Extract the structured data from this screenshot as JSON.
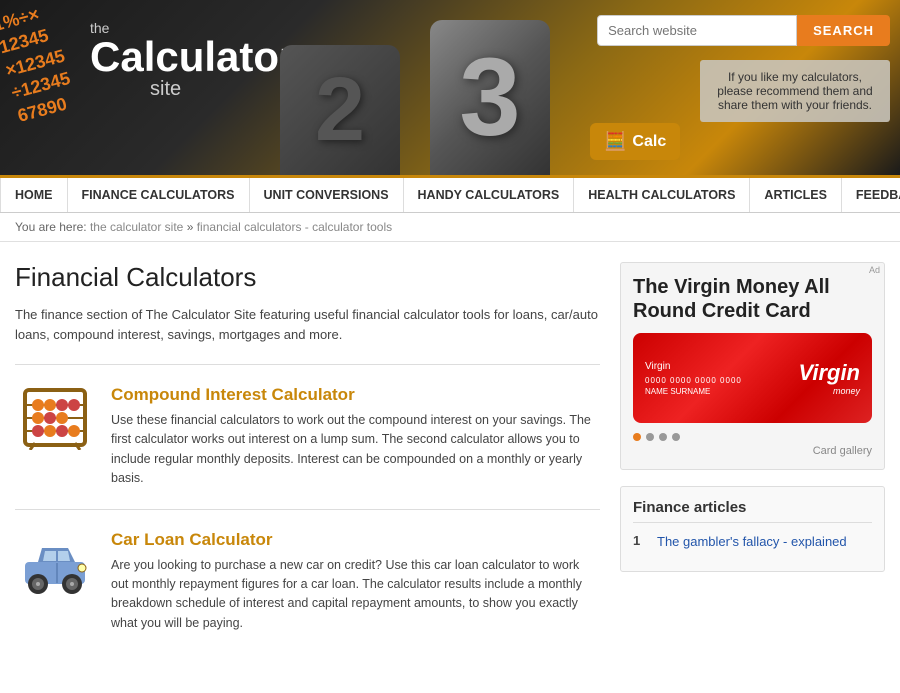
{
  "header": {
    "logo_the": "the",
    "logo_calculator": "Calculator",
    "logo_site": "site",
    "floating_numbers": "1%÷×\n12345\n×12345\n÷12345\n67890",
    "search_placeholder": "Search website",
    "search_btn_label": "SEARCH",
    "calc_icon_label": "Calc",
    "recommend_text": "If you like my calculators, please recommend them and share them with your friends."
  },
  "nav": {
    "items": [
      {
        "label": "HOME",
        "href": "#"
      },
      {
        "label": "FINANCE CALCULATORS",
        "href": "#"
      },
      {
        "label": "UNIT CONVERSIONS",
        "href": "#"
      },
      {
        "label": "HANDY CALCULATORS",
        "href": "#"
      },
      {
        "label": "HEALTH CALCULATORS",
        "href": "#"
      },
      {
        "label": "ARTICLES",
        "href": "#"
      },
      {
        "label": "FEEDBACK",
        "href": "#"
      }
    ]
  },
  "breadcrumb": {
    "prefix": "You are here:",
    "items": [
      {
        "label": "the calculator site",
        "href": "#"
      },
      {
        "label": "financial calculators - calculator tools",
        "href": "#"
      }
    ]
  },
  "main": {
    "page_title": "Financial Calculators",
    "intro": "The finance section of The Calculator Site featuring useful financial calculator tools for loans, car/auto loans, compound interest, savings, mortgages and more.",
    "calculators": [
      {
        "id": "compound-interest",
        "title": "Compound Interest Calculator",
        "description": "Use these financial calculators to work out the compound interest on your savings. The first calculator works out interest on a lump sum. The second calculator allows you to include regular monthly deposits. Interest can be compounded on a monthly or yearly basis.",
        "icon_type": "abacus"
      },
      {
        "id": "car-loan",
        "title": "Car Loan Calculator",
        "description": "Are you looking to purchase a new car on credit? Use this car loan calculator to work out monthly repayment figures for a car loan. The calculator results include a monthly breakdown schedule of interest and capital repayment amounts, to show you exactly what you will be paying.",
        "icon_type": "car"
      }
    ]
  },
  "sidebar": {
    "ad": {
      "ad_label": "Ad",
      "title": "The Virgin Money All Round Credit Card",
      "card_gallery_label": "Card gallery"
    },
    "finance_articles": {
      "title": "Finance articles",
      "articles": [
        {
          "num": "1",
          "label": "The gambler's fallacy - explained",
          "href": "#"
        }
      ]
    }
  }
}
